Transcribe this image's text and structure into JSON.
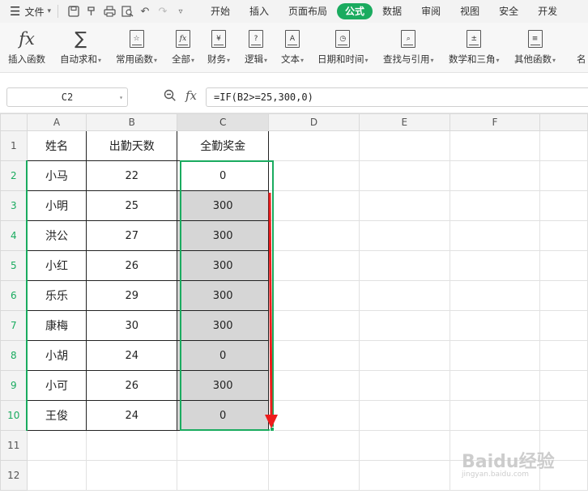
{
  "menu": {
    "file_label": "文件",
    "tabs": [
      "开始",
      "插入",
      "页面布局",
      "公式",
      "数据",
      "审阅",
      "视图",
      "安全",
      "开发"
    ],
    "active_tab": "公式"
  },
  "ribbon": {
    "buttons": [
      {
        "label": "插入函数",
        "dropdown": false,
        "icon": "fx-icon"
      },
      {
        "label": "自动求和",
        "dropdown": true,
        "icon": "sigma-icon"
      },
      {
        "label": "常用函数",
        "dropdown": true,
        "icon": "common-function-icon"
      },
      {
        "label": "全部",
        "dropdown": true,
        "icon": "all-function-icon"
      },
      {
        "label": "财务",
        "dropdown": true,
        "icon": "finance-icon"
      },
      {
        "label": "逻辑",
        "dropdown": true,
        "icon": "logic-icon"
      },
      {
        "label": "文本",
        "dropdown": true,
        "icon": "text-icon"
      },
      {
        "label": "日期和时间",
        "dropdown": true,
        "icon": "datetime-icon"
      },
      {
        "label": "查找与引用",
        "dropdown": true,
        "icon": "lookup-icon"
      },
      {
        "label": "数学和三角",
        "dropdown": true,
        "icon": "math-icon"
      },
      {
        "label": "其他函数",
        "dropdown": true,
        "icon": "other-function-icon"
      },
      {
        "label": "名",
        "dropdown": false,
        "icon": ""
      }
    ]
  },
  "formula_bar": {
    "name_box": "C2",
    "formula": "=IF(B2>=25,300,0)"
  },
  "sheet": {
    "columns": [
      "A",
      "B",
      "C",
      "D",
      "E",
      "F"
    ],
    "row_numbers": [
      "1",
      "2",
      "3",
      "4",
      "5",
      "6",
      "7",
      "8",
      "9",
      "10",
      "11",
      "12"
    ],
    "header": [
      "姓名",
      "出勤天数",
      "全勤奖金"
    ],
    "rows": [
      [
        "小马",
        "22",
        "0"
      ],
      [
        "小明",
        "25",
        "300"
      ],
      [
        "洪公",
        "27",
        "300"
      ],
      [
        "小红",
        "26",
        "300"
      ],
      [
        "乐乐",
        "29",
        "300"
      ],
      [
        "康梅",
        "30",
        "300"
      ],
      [
        "小胡",
        "24",
        "0"
      ],
      [
        "小可",
        "26",
        "300"
      ],
      [
        "王俊",
        "24",
        "0"
      ]
    ]
  },
  "colors": {
    "accent": "#1aab5f",
    "selection_fill": "#d6d6d6",
    "arrow": "#ee1c1c"
  },
  "watermark": {
    "text": "Baidu经验",
    "url": "jingyan.baidu.com"
  }
}
